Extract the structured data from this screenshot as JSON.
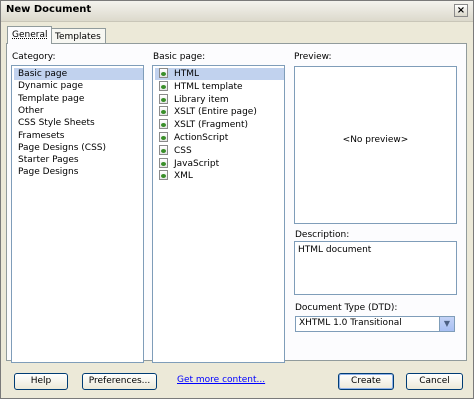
{
  "window": {
    "title": "New Document",
    "close_glyph": "×"
  },
  "tabs": [
    {
      "label": "General",
      "active": true
    },
    {
      "label": "Templates",
      "active": false
    }
  ],
  "category": {
    "label": "Category:",
    "items": [
      "Basic page",
      "Dynamic page",
      "Template page",
      "Other",
      "CSS Style Sheets",
      "Framesets",
      "Page Designs (CSS)",
      "Starter Pages",
      "Page Designs"
    ],
    "selected": "Basic page"
  },
  "basic_page": {
    "label": "Basic page:",
    "items": [
      "HTML",
      "HTML template",
      "Library item",
      "XSLT (Entire page)",
      "XSLT (Fragment)",
      "ActionScript",
      "CSS",
      "JavaScript",
      "XML"
    ],
    "selected": "HTML",
    "icon": "document-icon"
  },
  "preview": {
    "label": "Preview:",
    "text": "<No preview>"
  },
  "description": {
    "label": "Description:",
    "text": "HTML document"
  },
  "doctype": {
    "label": "Document Type (DTD):",
    "value": "XHTML 1.0 Transitional",
    "arrow": "▼"
  },
  "buttons": {
    "help": "Help",
    "preferences": "Preferences...",
    "get_more": "Get more content...",
    "create": "Create",
    "cancel": "Cancel"
  }
}
